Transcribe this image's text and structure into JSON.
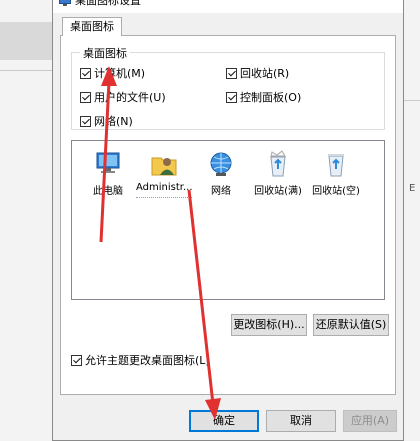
{
  "dialog": {
    "title": "桌面图标设置",
    "tab_label": "桌面图标"
  },
  "desktop_icons_group": {
    "title": "桌面图标",
    "checkboxes": [
      {
        "label": "计算机(M)",
        "checked": true
      },
      {
        "label": "回收站(R)",
        "checked": true
      },
      {
        "label": "用户的文件(U)",
        "checked": true
      },
      {
        "label": "控制面板(O)",
        "checked": true
      },
      {
        "label": "网络(N)",
        "checked": true
      }
    ]
  },
  "icon_list": {
    "items": [
      {
        "label": "此电脑",
        "icon": "computer-icon"
      },
      {
        "label": "Administr...",
        "icon": "user-folder-icon"
      },
      {
        "label": "网络",
        "icon": "network-icon"
      },
      {
        "label": "回收站(满)",
        "icon": "recycle-bin-full-icon"
      },
      {
        "label": "回收站(空)",
        "icon": "recycle-bin-empty-icon"
      }
    ]
  },
  "buttons": {
    "change_icon": "更改图标(H)...",
    "restore_default": "还原默认值(S)",
    "ok": "确定",
    "cancel": "取消",
    "apply": "应用(A)"
  },
  "allow_themes": {
    "label": "允许主题更改桌面图标(L)",
    "checked": true
  },
  "background": {
    "right_text": "E"
  },
  "annotation_color": "#e03030"
}
